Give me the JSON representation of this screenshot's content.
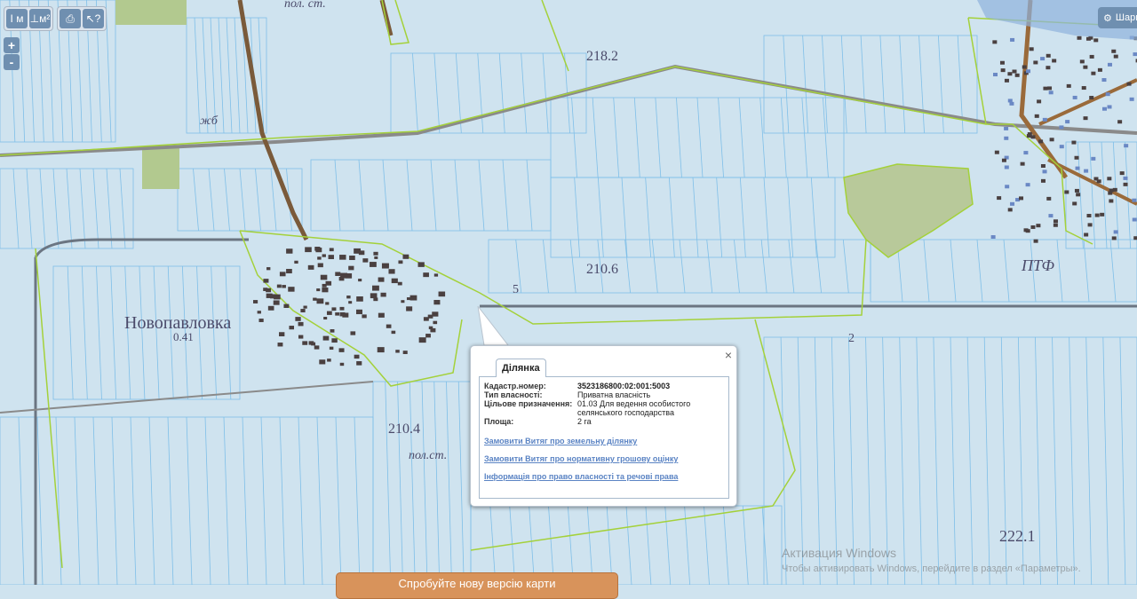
{
  "map": {
    "labels": [
      {
        "text": "Новопавловка"
      },
      {
        "text": "0.41"
      },
      {
        "text": "210.4"
      },
      {
        "text": "210.6"
      },
      {
        "text": "218.2"
      },
      {
        "text": "222.1"
      },
      {
        "text": "ПТФ"
      },
      {
        "text": "пол. ст."
      },
      {
        "text": "пол.ст."
      },
      {
        "text": "жб"
      },
      {
        "text": "2"
      },
      {
        "text": "5"
      }
    ]
  },
  "toolbar": {
    "buttons": [
      {
        "name": "measure-distance-icon",
        "glyph": "I м"
      },
      {
        "name": "measure-area-icon",
        "glyph": "⊥м²"
      },
      {
        "name": "print-icon",
        "glyph": "⎙"
      },
      {
        "name": "select-info-icon",
        "glyph": "↖?"
      }
    ],
    "zoom_in": "+",
    "zoom_out": "-",
    "settings_label": "Шари"
  },
  "popup": {
    "tab_title": "Ділянка",
    "close": "×",
    "fields": [
      {
        "label": "Кадастр.номер:",
        "value": "3523186800:02:001:5003"
      },
      {
        "label": "Тип власності:",
        "value": "Приватна власність"
      },
      {
        "label": "Цільове призначення:",
        "value": "01.03 Для ведення особистого селянського господарства"
      },
      {
        "label": "Площа:",
        "value": "2 га"
      }
    ],
    "links": [
      "Замовити Витяг про земельну ділянку",
      "Замовити Витяг про нормативну грошову оцінку",
      "Інформація про право власності та речові права"
    ]
  },
  "banner": {
    "text": "Спробуйте нову версію карти"
  },
  "watermark": {
    "title": "Активация Windows",
    "subtitle": "Чтобы активировать Windows, перейдите в раздел «Параметры»."
  },
  "colors": {
    "map_background": "#cfe3ef",
    "parcel_lines": "#7fbfe8",
    "boundary_green": "#a4d13a",
    "road_dark": "#5c5c5c",
    "road_brown": "#9a6a3a",
    "banner": "#d8935b",
    "link": "#5b84c4"
  }
}
